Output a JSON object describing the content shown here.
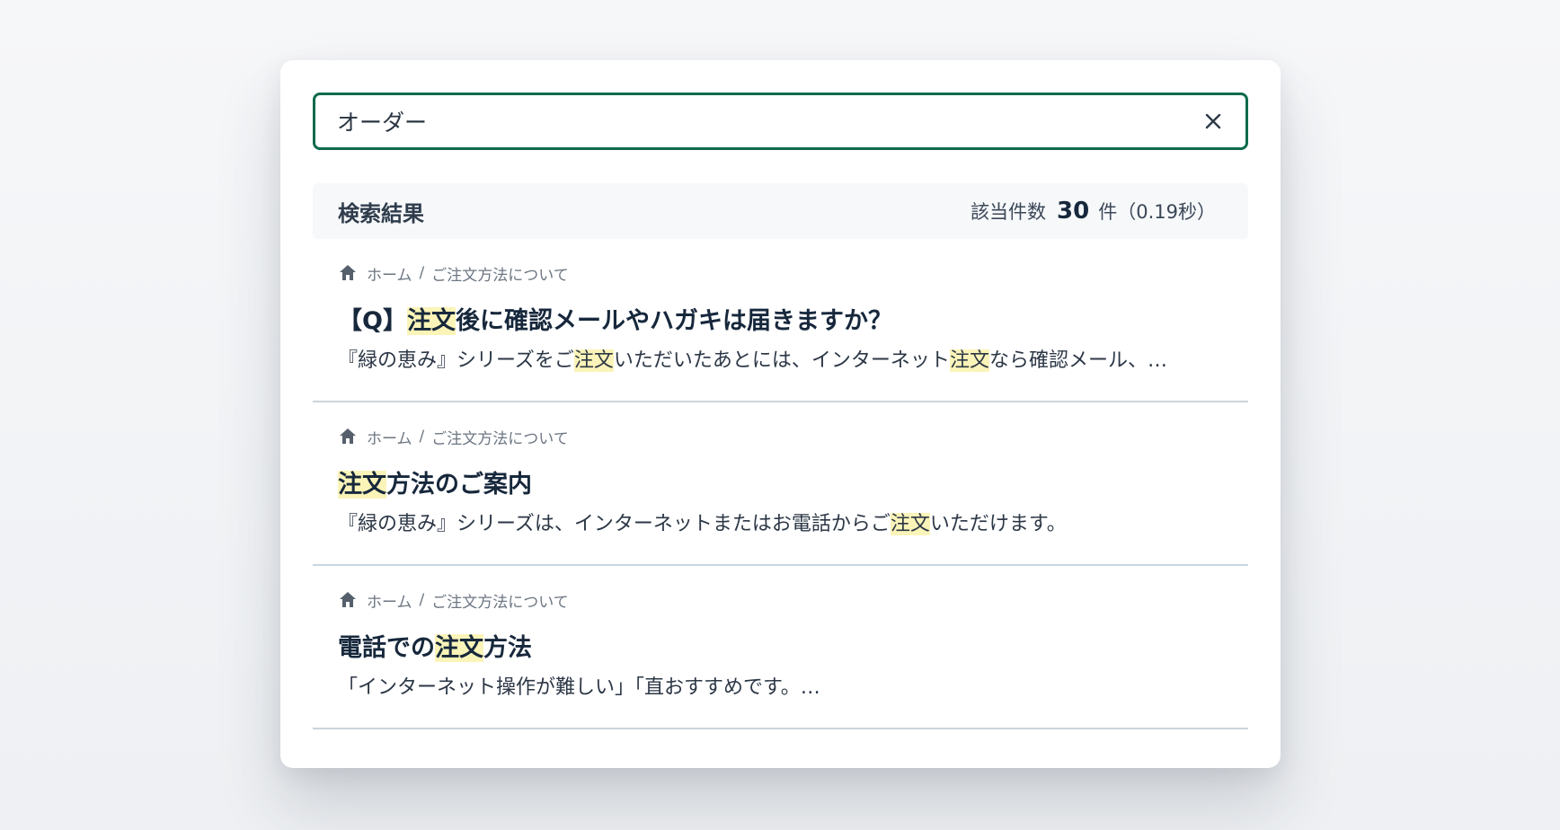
{
  "search": {
    "value": "オーダー",
    "placeholder": ""
  },
  "results_header": {
    "title": "検索結果",
    "count_label": "該当件数",
    "count": "30",
    "count_suffix": "件（0.19秒）"
  },
  "icons": {
    "clear": "close-icon",
    "breadcrumb_home": "home-icon"
  },
  "colors": {
    "search_border": "#0f6b4a",
    "highlight": "#fbf4b8",
    "title_text": "#17283c"
  },
  "results": [
    {
      "breadcrumb": {
        "home": "ホーム",
        "separator": "/",
        "category": "ご注文方法について"
      },
      "title": {
        "pre": "【Q】",
        "hl": "注文",
        "post": "後に確認メールやハガキは届きますか？"
      },
      "snippet": {
        "a": "『緑の恵み』シリーズをご",
        "hl1": "注文",
        "b": "いただいたあとには、インターネット",
        "hl2": "注文",
        "c": "なら確認メール、…"
      }
    },
    {
      "breadcrumb": {
        "home": "ホーム",
        "separator": "/",
        "category": "ご注文方法について"
      },
      "title": {
        "pre": "",
        "hl": "注文",
        "post": "方法のご案内"
      },
      "snippet": {
        "a": "『緑の恵み』シリーズは、インターネットまたはお電話からご",
        "hl1": "注文",
        "b": "いただけます。"
      }
    },
    {
      "breadcrumb": {
        "home": "ホーム",
        "separator": "/",
        "category": "ご注文方法について"
      },
      "title": {
        "pre": "電話での",
        "hl": "注文",
        "post": "方法"
      },
      "snippet": {
        "a": "「インターネット操作が難しい」「直おすすめです。…"
      }
    }
  ]
}
